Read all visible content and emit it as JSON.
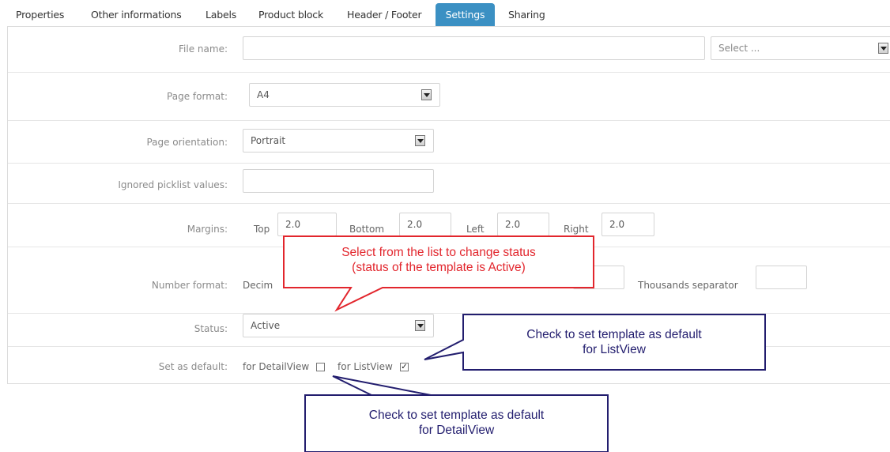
{
  "tabs": [
    {
      "label": "Properties"
    },
    {
      "label": "Other informations"
    },
    {
      "label": "Labels"
    },
    {
      "label": "Product block"
    },
    {
      "label": "Header / Footer"
    },
    {
      "label": "Settings",
      "active": true
    },
    {
      "label": "Sharing"
    }
  ],
  "form": {
    "file_name": {
      "label": "File name:",
      "value": "",
      "select_placeholder": "Select ..."
    },
    "page_format": {
      "label": "Page format:",
      "value": "A4"
    },
    "page_orientation": {
      "label": "Page orientation:",
      "value": "Portrait"
    },
    "ignored_picklist": {
      "label": "Ignored picklist values:",
      "value": ""
    },
    "margins": {
      "label": "Margins:",
      "top_label": "Top",
      "top_value": "2.0",
      "bottom_label": "Bottom",
      "bottom_value": "2.0",
      "left_label": "Left",
      "left_value": "2.0",
      "right_label": "Right",
      "right_value": "2.0"
    },
    "number_format": {
      "label": "Number format:",
      "decimal_label": "Decim",
      "decimal_value": "",
      "thousands_label": "Thousands separator",
      "thousands_value": ""
    },
    "status": {
      "label": "Status:",
      "value": "Active"
    },
    "set_default": {
      "label": "Set as default:",
      "detailview_label": "for DetailView",
      "detailview_checked": false,
      "listview_label": "for ListView",
      "listview_checked": true
    }
  },
  "callouts": {
    "status": {
      "line1": "Select from the list to change status",
      "line2": "(status of the template is Active)"
    },
    "listview": {
      "line1": "Check to set template as default",
      "line2": "for ListView"
    },
    "detailview": {
      "line1": "Check to set template as default",
      "line2": "for DetailView"
    }
  },
  "colors": {
    "active_tab": "#3b90c3",
    "callout_red": "#e2262d",
    "callout_blue": "#221d6e"
  }
}
